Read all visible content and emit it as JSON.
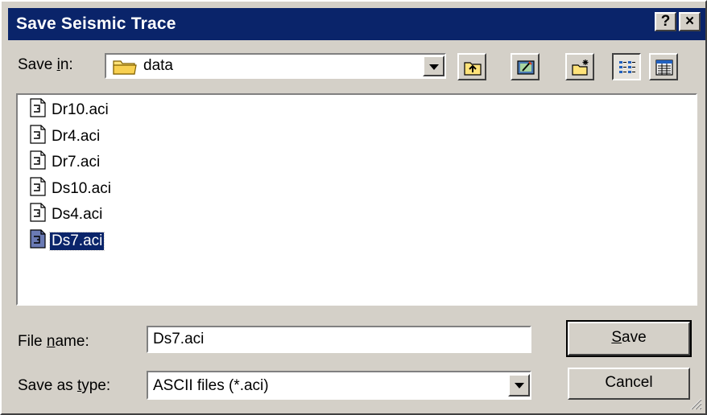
{
  "window": {
    "title": "Save Seismic Trace",
    "help_button": "?",
    "close_button": "×"
  },
  "save_in": {
    "label_prefix": "Save ",
    "label_accel": "i",
    "label_suffix": "n:",
    "folder_icon": "folder-icon",
    "value": "data"
  },
  "toolbar": {
    "buttons": [
      {
        "name": "up-one-level",
        "icon": "up-folder-icon"
      },
      {
        "name": "desktop",
        "icon": "desktop-icon"
      },
      {
        "name": "create-new-folder",
        "icon": "new-folder-icon"
      },
      {
        "name": "list-view",
        "icon": "list-view-icon",
        "pressed": true
      },
      {
        "name": "details-view",
        "icon": "details-view-icon"
      }
    ]
  },
  "files": [
    {
      "name": "Dr10.aci"
    },
    {
      "name": "Dr4.aci"
    },
    {
      "name": "Dr7.aci"
    },
    {
      "name": "Ds10.aci"
    },
    {
      "name": "Ds4.aci"
    },
    {
      "name": "Ds7.aci",
      "selected": true
    }
  ],
  "file_name": {
    "label_prefix": "File ",
    "label_accel": "n",
    "label_suffix": "ame:",
    "value": "Ds7.aci"
  },
  "save_as_type": {
    "label_prefix": "Save as ",
    "label_accel": "t",
    "label_suffix": "ype:",
    "value": "ASCII files (*.aci)"
  },
  "buttons": {
    "save_accel": "S",
    "save_rest": "ave",
    "cancel": "Cancel"
  },
  "colors": {
    "face": "#d4d0c8",
    "title_bar": "#0a246a",
    "selection": "#0a246a"
  }
}
